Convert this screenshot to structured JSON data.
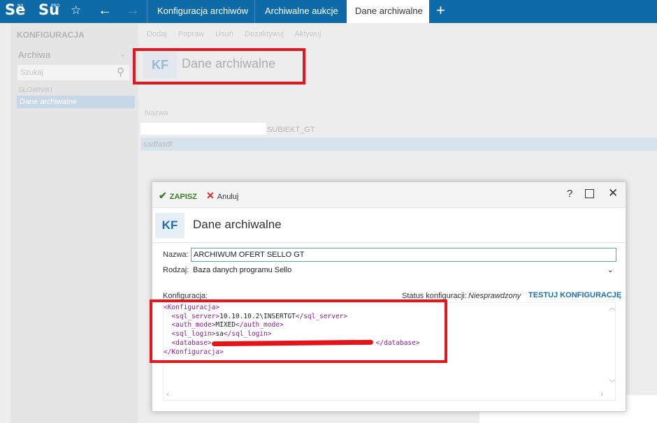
{
  "topbar": {
    "logo_se": "Se",
    "logo_se_sup": "NX",
    "logo_su": "Su",
    "logo_su_sup": "PRO",
    "star_icon": "star-icon",
    "back_icon": "arrow-left-icon",
    "forward_icon": "arrow-right-icon",
    "tabs": [
      {
        "label": "Konfiguracja archiwów"
      },
      {
        "label": "Archiwalne aukcje"
      },
      {
        "label": "Dane archiwalne"
      }
    ],
    "add_tab_icon": "plus-icon"
  },
  "sidebar": {
    "section_title": "KONFIGURACJA",
    "group_label": "Archiwa",
    "search_placeholder": "Szukaj",
    "category_label": "SŁOWNIKI",
    "selected_item": "Dane archiwalne"
  },
  "main": {
    "toolbar": [
      "Dodaj",
      "Popraw",
      "Usuń",
      "Dezaktywuj",
      "Aktywuj"
    ],
    "badge": "KF",
    "title": "Dane archiwalne",
    "column_header": "Nazwa",
    "rows": [
      {
        "name": "SUBIEKT_GT"
      },
      {
        "name": "sadfasdf"
      }
    ]
  },
  "dialog": {
    "save_label": "ZAPISZ",
    "cancel_label": "Anuluj",
    "help_label": "?",
    "badge": "KF",
    "title": "Dane archiwalne",
    "name_label": "Nazwa:",
    "name_value": "ARCHIWUM OFERT SELLO GT",
    "kind_label": "Rodzaj:",
    "kind_value": "Baza danych programu Sello",
    "config_label": "Konfiguracja:",
    "status_label": "Status konfiguracji:",
    "status_value": "Niesprawdzony",
    "test_label": "TESTUJ KONFIGURACJĘ",
    "xml": {
      "root_open": "<Konfiguracja>",
      "server_open": "<sql_server>",
      "server_value": "10.10.10.2\\INSERTGT",
      "server_close": "</sql_server>",
      "auth_open": "<auth_mode>",
      "auth_value": "MIXED",
      "auth_close": "</auth_mode>",
      "login_open": "<sql_login>",
      "login_value": "sa",
      "login_close": "</sql_login>",
      "db_open": "<database>",
      "db_close": "</database>",
      "root_close": "</Konfiguracja>"
    }
  },
  "colors": {
    "accent": "#0e6ba8",
    "annotation": "#e5161c",
    "save": "#3a7d22",
    "link": "#1a6fb0"
  }
}
